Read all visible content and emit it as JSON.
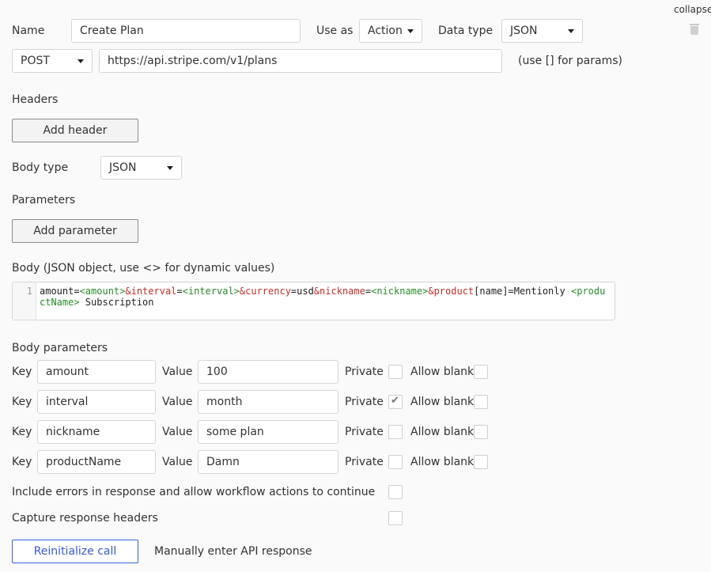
{
  "header": {
    "collapse_label": "collapse",
    "trash_icon": "trash-icon"
  },
  "call": {
    "name_label": "Name",
    "name_value": "Create Plan",
    "use_as_label": "Use as",
    "use_as_value": "Action",
    "data_type_label": "Data type",
    "data_type_value": "JSON",
    "method": "POST",
    "url": "https://api.stripe.com/v1/plans",
    "url_hint": "(use [] for params)"
  },
  "headers_section": {
    "title": "Headers",
    "add_button": "Add header"
  },
  "body_type": {
    "label": "Body type",
    "value": "JSON"
  },
  "parameters_section": {
    "title": "Parameters",
    "add_button": "Add parameter"
  },
  "body": {
    "label": "Body (JSON object, use <> for dynamic values)",
    "line_number": "1",
    "tokens": [
      {
        "t": "amount=",
        "c": "plain"
      },
      {
        "t": "<amount>",
        "c": "tag"
      },
      {
        "t": "&interval",
        "c": "amp"
      },
      {
        "t": "=",
        "c": "plain"
      },
      {
        "t": "<interval>",
        "c": "tag"
      },
      {
        "t": "&currency",
        "c": "amp"
      },
      {
        "t": "=usd",
        "c": "plain"
      },
      {
        "t": "&nickname",
        "c": "amp"
      },
      {
        "t": "=",
        "c": "plain"
      },
      {
        "t": "<nickname>",
        "c": "tag"
      },
      {
        "t": "&product",
        "c": "amp"
      },
      {
        "t": "[name]=Mentionly ",
        "c": "plain"
      },
      {
        "t": "<productName>",
        "c": "tag"
      },
      {
        "t": " Subscription",
        "c": "plain"
      }
    ]
  },
  "body_parameters": {
    "title": "Body parameters",
    "key_label": "Key",
    "value_label": "Value",
    "private_label": "Private",
    "allow_blank_label": "Allow blank",
    "rows": [
      {
        "key": "amount",
        "value": "100",
        "private": false,
        "allow_blank": false
      },
      {
        "key": "interval",
        "value": "month",
        "private": true,
        "allow_blank": false
      },
      {
        "key": "nickname",
        "value": "some plan",
        "private": false,
        "allow_blank": false
      },
      {
        "key": "productName",
        "value": "Damn",
        "private": false,
        "allow_blank": false
      }
    ]
  },
  "options": {
    "include_errors_label": "Include errors in response and allow workflow actions to continue",
    "include_errors_checked": false,
    "capture_headers_label": "Capture response headers",
    "capture_headers_checked": false
  },
  "footer": {
    "reinitialize_button": "Reinitialize call",
    "manual_link": "Manually enter API response"
  },
  "colors": {
    "accent": "#3a64d8",
    "tag": "#2a8a2a",
    "amp": "#c0302b"
  }
}
